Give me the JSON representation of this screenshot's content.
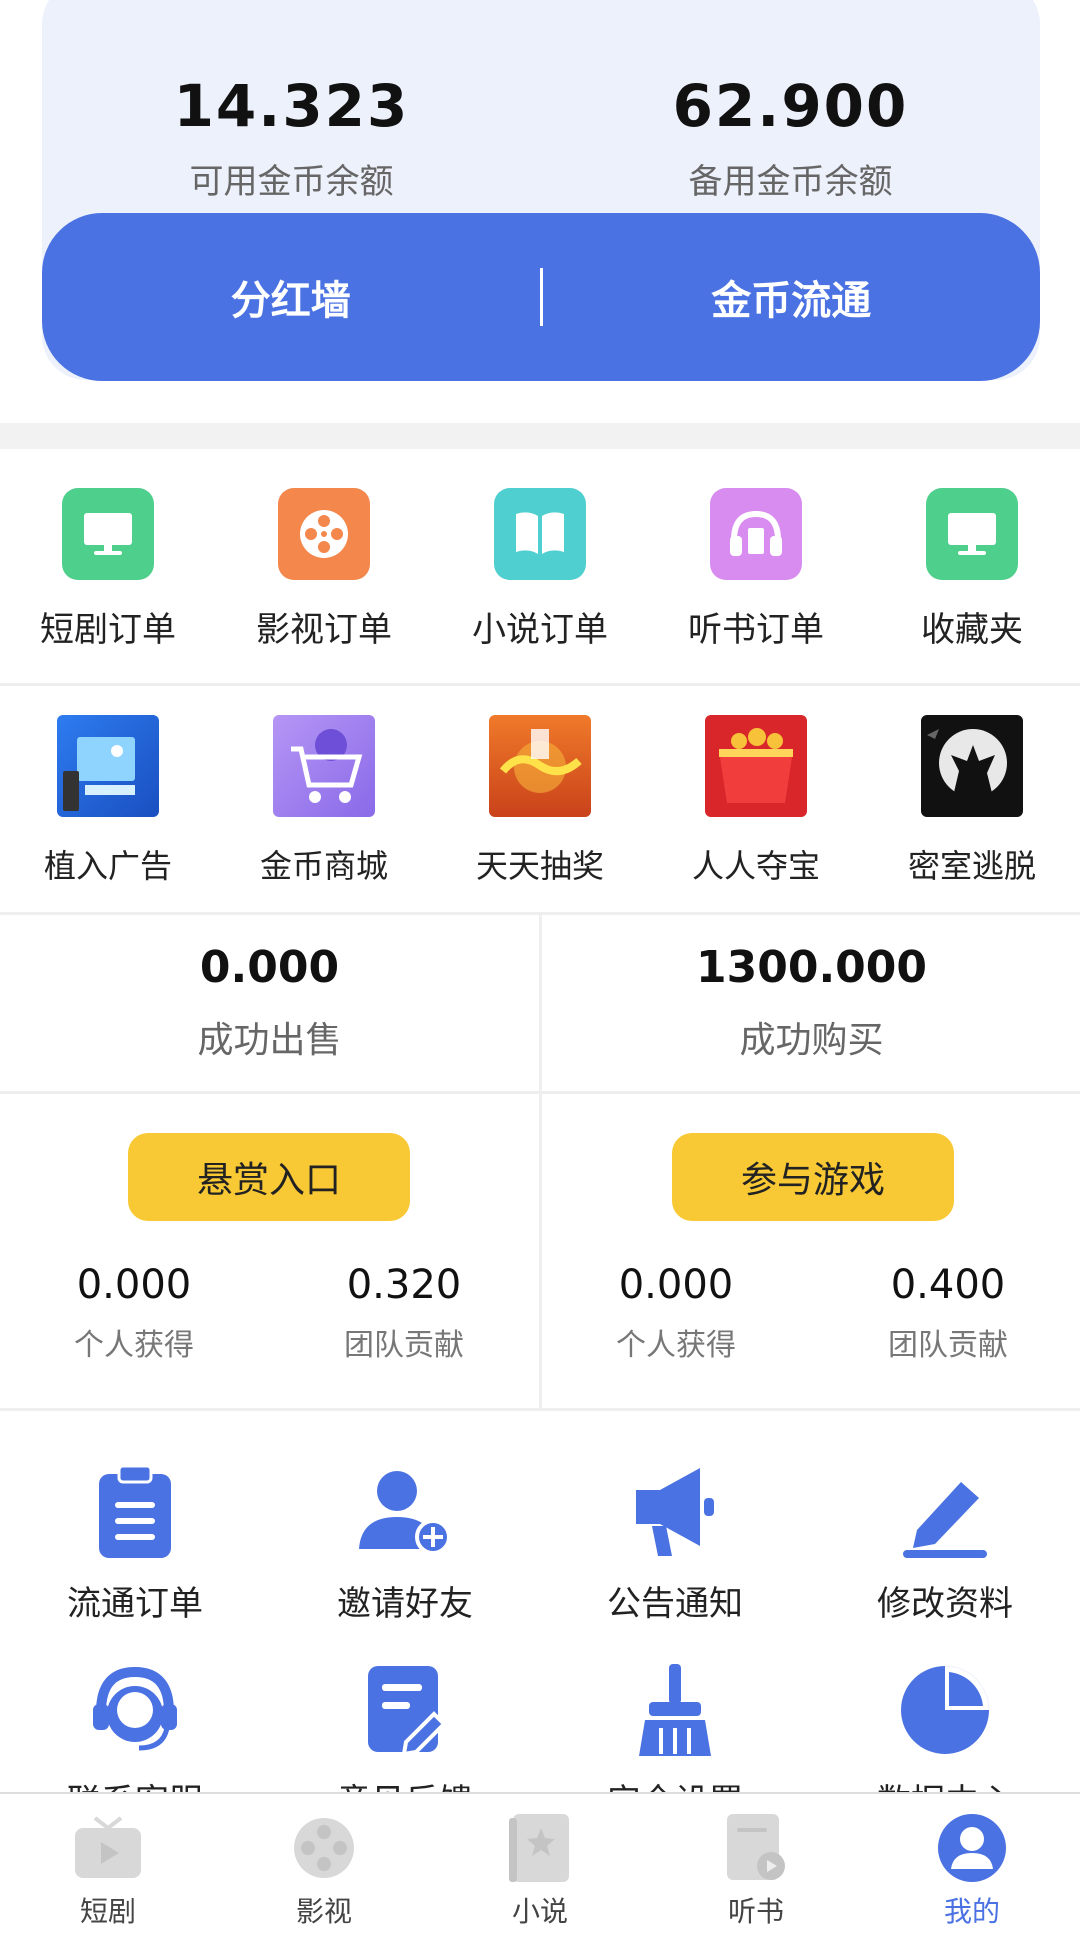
{
  "balances": [
    {
      "value": "14.323",
      "label": "可用金币余额"
    },
    {
      "value": "62.900",
      "label": "备用金币余额"
    }
  ],
  "actions": {
    "left": "分红墙",
    "right": "金币流通"
  },
  "orders_row": [
    {
      "label": "短剧订单",
      "icon": "monitor-icon",
      "color": "#4fcf8c"
    },
    {
      "label": "影视订单",
      "icon": "film-reel-icon",
      "color": "#f4874c"
    },
    {
      "label": "小说订单",
      "icon": "book-icon",
      "color": "#4fcfcf"
    },
    {
      "label": "听书订单",
      "icon": "headphones-icon",
      "color": "#d98cf0"
    },
    {
      "label": "收藏夹",
      "icon": "monitor-icon",
      "color": "#4fcf8c"
    }
  ],
  "services_row": [
    {
      "label": "植入广告",
      "icon": "ad-placement-image"
    },
    {
      "label": "金币商城",
      "icon": "shopping-cart-image"
    },
    {
      "label": "天天抽奖",
      "icon": "lottery-image"
    },
    {
      "label": "人人夺宝",
      "icon": "treasure-bowl-image"
    },
    {
      "label": "密室逃脱",
      "icon": "escape-room-image"
    }
  ],
  "stats": [
    {
      "value": "0.000",
      "label": "成功出售"
    },
    {
      "value": "1300.000",
      "label": "成功购买"
    }
  ],
  "reward": {
    "button": "悬赏入口",
    "personal_value": "0.000",
    "personal_label": "个人获得",
    "team_value": "0.320",
    "team_label": "团队贡献"
  },
  "game": {
    "button": "参与游戏",
    "personal_value": "0.000",
    "personal_label": "个人获得",
    "team_value": "0.400",
    "team_label": "团队贡献"
  },
  "tools": [
    {
      "label": "流通订单",
      "icon": "clipboard-icon"
    },
    {
      "label": "邀请好友",
      "icon": "add-user-icon"
    },
    {
      "label": "公告通知",
      "icon": "megaphone-icon"
    },
    {
      "label": "修改资料",
      "icon": "edit-pen-icon"
    },
    {
      "label": "联系客服",
      "icon": "headset-icon"
    },
    {
      "label": "意见反馈",
      "icon": "feedback-icon"
    },
    {
      "label": "安全设置",
      "icon": "broom-icon"
    },
    {
      "label": "数据中心",
      "icon": "pie-chart-icon"
    }
  ],
  "nav": [
    {
      "label": "短剧",
      "icon": "tv-play-icon",
      "active": false
    },
    {
      "label": "影视",
      "icon": "film-reel-icon",
      "active": false
    },
    {
      "label": "小说",
      "icon": "book-star-icon",
      "active": false
    },
    {
      "label": "听书",
      "icon": "audio-book-icon",
      "active": false
    },
    {
      "label": "我的",
      "icon": "user-profile-icon",
      "active": true
    }
  ],
  "colors": {
    "primary": "#4a72e2",
    "yellow": "#f8c935",
    "card_bg": "#edf1fb"
  }
}
